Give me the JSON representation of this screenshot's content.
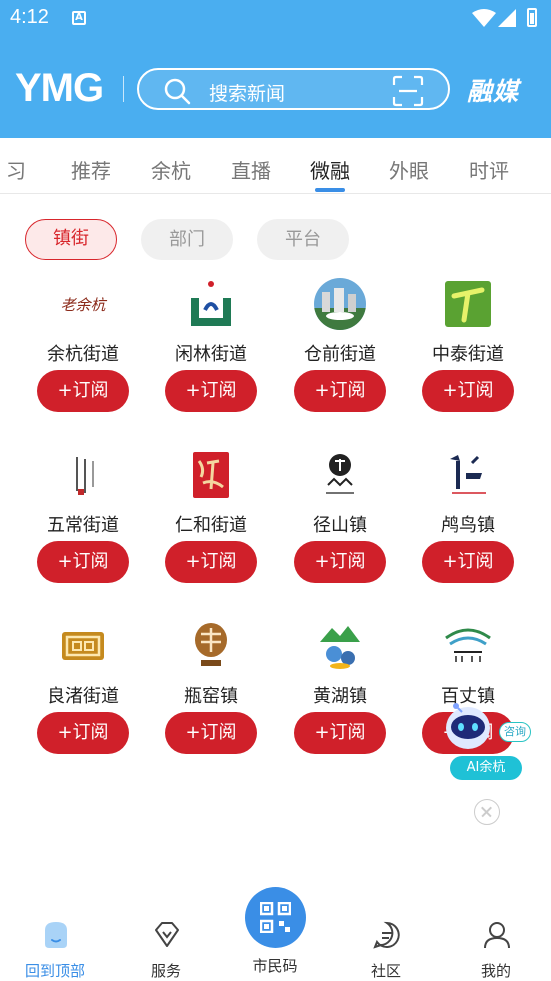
{
  "status_bar": {
    "time": "4:12",
    "notification_icon": "A"
  },
  "header": {
    "logo_text": "YMG",
    "search_placeholder": "搜索新闻",
    "brand_text": "融媒",
    "colors": {
      "header_bg": "#4aaef0"
    }
  },
  "tabs": {
    "items": [
      "习",
      "推荐",
      "余杭",
      "直播",
      "微融",
      "外眼",
      "时评"
    ],
    "active": "微融"
  },
  "filters": {
    "items": [
      "镇街",
      "部门",
      "平台"
    ],
    "active": "镇街"
  },
  "subscribe_label": "+订阅",
  "grid": [
    {
      "name": "余杭街道",
      "logo": "yuhang-logo"
    },
    {
      "name": "闲林街道",
      "logo": "xianlin-logo"
    },
    {
      "name": "仓前街道",
      "logo": "cangqian-logo"
    },
    {
      "name": "中泰街道",
      "logo": "zhongtai-logo"
    },
    {
      "name": "五常街道",
      "logo": "wuchang-logo"
    },
    {
      "name": "仁和街道",
      "logo": "renhe-logo"
    },
    {
      "name": "径山镇",
      "logo": "jingshan-logo"
    },
    {
      "name": "鸬鸟镇",
      "logo": "luniao-logo"
    },
    {
      "name": "良渚街道",
      "logo": "liangzhu-logo"
    },
    {
      "name": "瓶窑镇",
      "logo": "pingyao-logo"
    },
    {
      "name": "黄湖镇",
      "logo": "huanghu-logo"
    },
    {
      "name": "百丈镇",
      "logo": "baizhang-logo"
    }
  ],
  "ai_assistant": {
    "consult_label": "咨询",
    "name": "AI余杭"
  },
  "bottom_nav": {
    "items": [
      {
        "label": "回到顶部",
        "icon": "back-to-top-icon"
      },
      {
        "label": "服务",
        "icon": "diamond-icon"
      },
      {
        "label": "市民码",
        "icon": "qr-code-icon"
      },
      {
        "label": "社区",
        "icon": "chat-icon"
      },
      {
        "label": "我的",
        "icon": "user-icon"
      }
    ]
  },
  "colors": {
    "accent_red": "#d0202a",
    "accent_blue": "#3a8ee6"
  }
}
